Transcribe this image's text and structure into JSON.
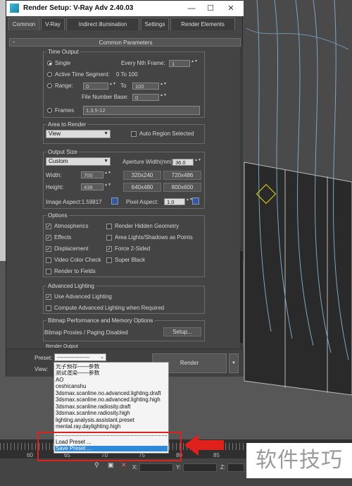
{
  "window": {
    "title": "Render Setup: V-Ray Adv 2.40.03"
  },
  "tabs": [
    "Common",
    "V-Ray",
    "Indirect illumination",
    "Settings",
    "Render Elements"
  ],
  "rollout_title": "Common Parameters",
  "time_output": {
    "group": "Time Output",
    "single": "Single",
    "every_nth": "Every Nth Frame:",
    "every_nth_value": "1",
    "active_segment": "Active Time Segment:",
    "active_segment_range": "0 To 100",
    "range": "Range:",
    "range_from": "0",
    "range_to_label": "To",
    "range_to": "100",
    "file_number_base": "File Number Base:",
    "file_number_base_value": "0",
    "frames": "Frames",
    "frames_value": "1,3,5-12"
  },
  "area_to_render": {
    "group": "Area to Render",
    "select": "View",
    "auto_region": "Auto Region Selected"
  },
  "output_size": {
    "group": "Output Size",
    "select": "Custom",
    "aperture_label": "Aperture Width(mm):",
    "aperture_value": "36.0",
    "width_label": "Width:",
    "width_value": "700",
    "height_label": "Height:",
    "height_value": "438",
    "presets": [
      "320x240",
      "720x486",
      "640x480",
      "800x600"
    ],
    "image_aspect": "Image Aspect:1.59817",
    "pixel_aspect_label": "Pixel Aspect:",
    "pixel_aspect_value": "1.0"
  },
  "options": {
    "group": "Options",
    "atmospherics": "Atmospherics",
    "render_hidden": "Render Hidden Geometry",
    "effects": "Effects",
    "area_lights": "Area Lights/Shadows as Points",
    "displacement": "Displacement",
    "force_2sided": "Force 2-Sided",
    "video_color": "Video Color Check",
    "super_black": "Super Black",
    "render_to_fields": "Render to Fields"
  },
  "advanced_lighting": {
    "group": "Advanced Lighting",
    "use": "Use Advanced Lighting",
    "compute": "Compute Advanced Lighting when Required"
  },
  "bitmap": {
    "group": "Bitmap Performance and Memory Options",
    "text": "Bitmap Proxies / Paging Disabled",
    "setup": "Setup..."
  },
  "render_output_partial": "Render Output",
  "bottom": {
    "preset_label": "Preset:",
    "preset_value": "--------------------",
    "view_label": "View:",
    "render": "Render"
  },
  "preset_menu": {
    "items": [
      "光子预存——参数",
      "测试渲染——参数",
      "AO",
      "ceshicanshu",
      "3dsmax.scanline.no.advanced.lighting.draft",
      "3dsmax.scanline.no.advanced.lighting.high",
      "3dsmax.scanline.radiosity.draft",
      "3dsmax.scanline.radiosity.high",
      "lighting.analysis.assistant.preset",
      "mental.ray.daylighting.high"
    ],
    "load": "Load Preset ...",
    "save": "Save Preset ..."
  },
  "timeline": {
    "ticks": [
      "60",
      "65",
      "70",
      "75",
      "80",
      "85"
    ]
  },
  "coords": {
    "x": "X:",
    "y": "Y:",
    "z": "Z:"
  },
  "watermark": "软件技巧",
  "colors": {
    "highlight": "#2f89d8",
    "annotation": "#e0201a",
    "app_icon": "#38c0d8"
  }
}
